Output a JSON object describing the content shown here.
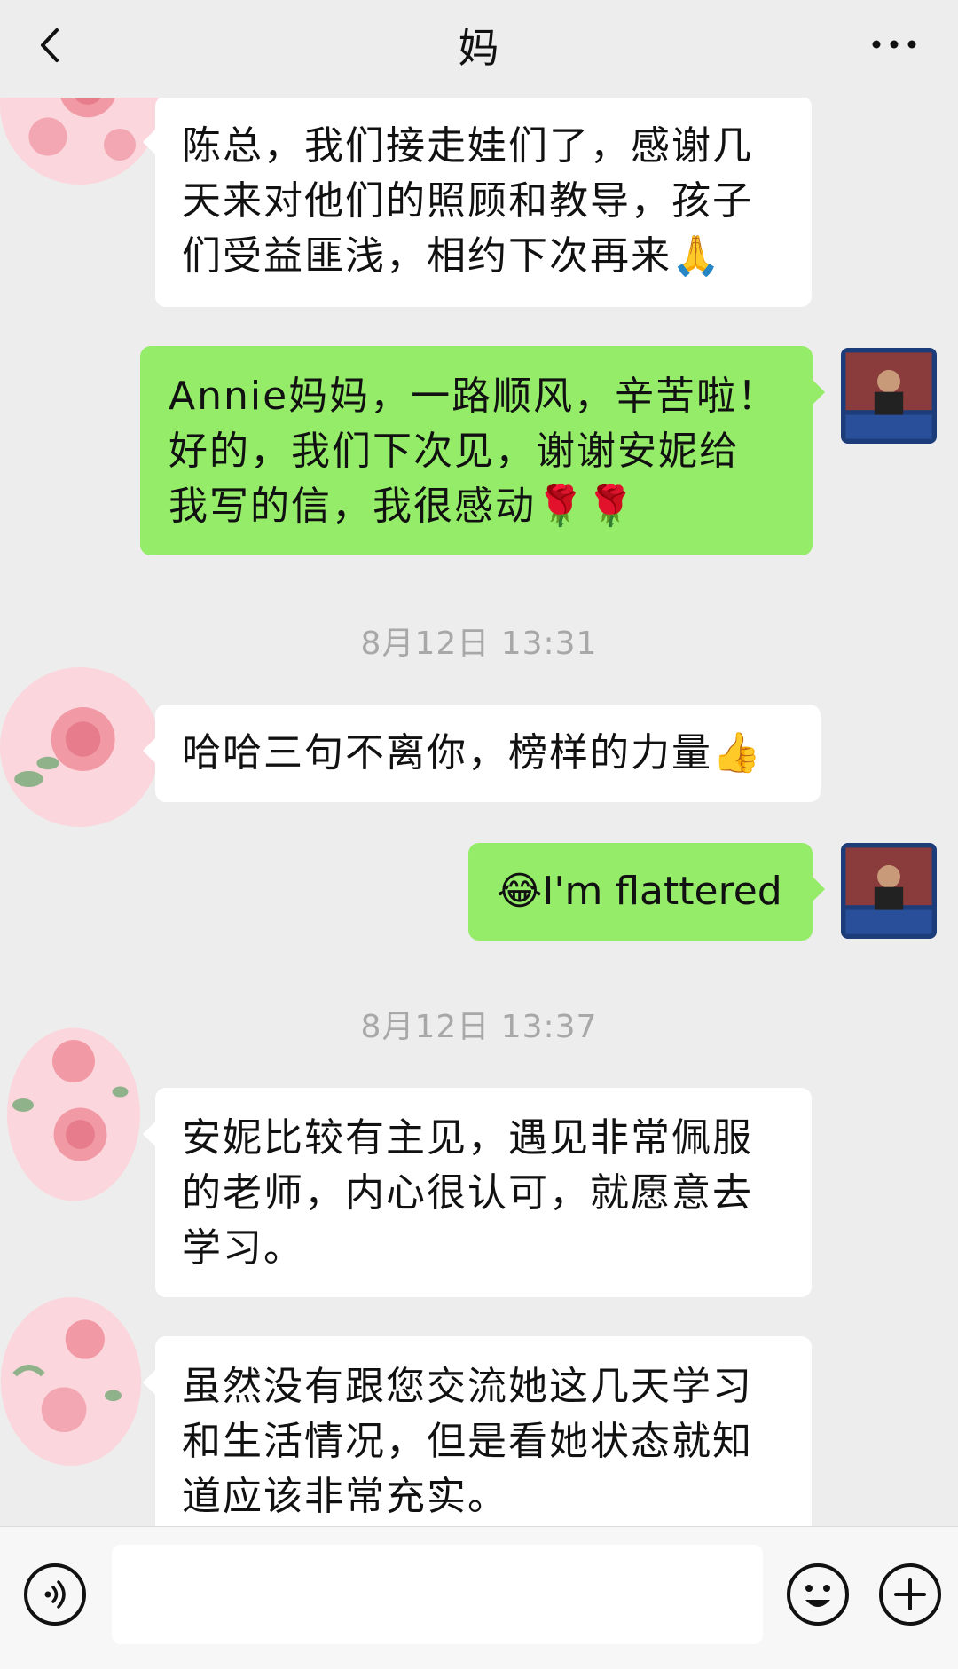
{
  "header": {
    "title": "妈"
  },
  "messages": [
    {
      "dir": "in",
      "lines": [
        "陈总，我们接走娃们了，感谢几",
        "天来对他们的照顾和教导，孩子",
        "们受益匪浅，相约下次再来🙏"
      ]
    },
    {
      "dir": "out",
      "lines": [
        "Annie妈妈，一路顺风，辛苦啦！",
        "好的，我们下次见，谢谢安妮给",
        "我写的信，我很感动🌹🌹"
      ]
    },
    {
      "dir": "in",
      "lines": [
        "哈哈三句不离你，榜样的力量👍"
      ]
    },
    {
      "dir": "out",
      "lines": [
        "😂I'm flattered"
      ]
    },
    {
      "dir": "in",
      "lines": [
        "安妮比较有主见，遇见非常佩服",
        "的老师，内心很认可，就愿意去",
        "学习。"
      ]
    },
    {
      "dir": "in",
      "lines": [
        "虽然没有跟您交流她这几天学习",
        "和生活情况，但是看她状态就知",
        "道应该非常充实。"
      ]
    }
  ],
  "timestamps": [
    "8月12日 13:31",
    "8月12日 13:37"
  ],
  "input": {
    "value": ""
  },
  "icons": {
    "back": "chevron-left-icon",
    "more": "more-dots-icon",
    "voice": "voice-icon",
    "emoji": "emoji-icon",
    "plus": "plus-icon"
  },
  "colors": {
    "background": "#ededed",
    "incoming_bubble": "#ffffff",
    "outgoing_bubble": "#95ec69",
    "timestamp": "#a8a8a8"
  }
}
